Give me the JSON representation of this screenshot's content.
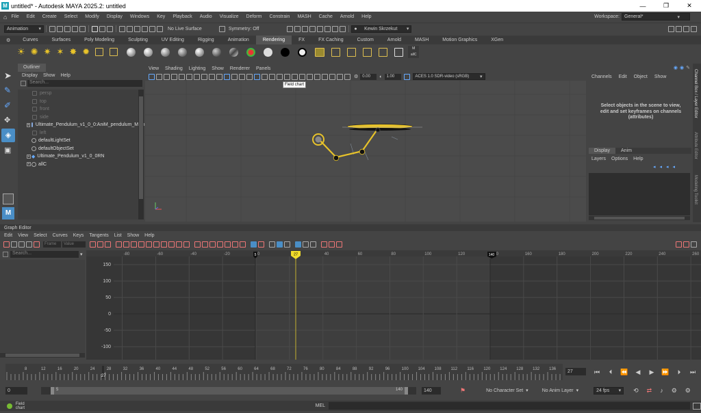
{
  "window": {
    "title": "untitled* - Autodesk MAYA 2025.2: untitled",
    "controls": [
      "—",
      "❐",
      "✕"
    ]
  },
  "main_menu": [
    "File",
    "Edit",
    "Create",
    "Select",
    "Modify",
    "Display",
    "Windows",
    "Key",
    "Playback",
    "Audio",
    "Visualize",
    "Deform",
    "Constrain",
    "MASH",
    "Cache",
    "Arnold",
    "Help"
  ],
  "workspace": {
    "label": "Workspace:",
    "value": "General*"
  },
  "status_line": {
    "menu_set": "Animation",
    "live_surface": "No Live Surface",
    "symmetry": "Symmetry: Off",
    "user": "Kewin Skrzekut"
  },
  "shelf_tabs": [
    "Curves",
    "Surfaces",
    "Poly Modeling",
    "Sculpting",
    "UV Editing",
    "Rigging",
    "Animation",
    "Rendering",
    "FX",
    "FX Caching",
    "Custom",
    "Arnold",
    "MASH",
    "Motion Graphics",
    "XGen"
  ],
  "shelf_active": "Rendering",
  "shelf_last_label": "allC",
  "outliner": {
    "title": "Outliner",
    "menu": [
      "Display",
      "Show",
      "Help"
    ],
    "search_placeholder": "Search...",
    "items": [
      {
        "label": "persp"
      },
      {
        "label": "top"
      },
      {
        "label": "front"
      },
      {
        "label": "side"
      },
      {
        "label": "Ultimate_Pendulum_v1_0_0:AniM_pendulum_Main"
      },
      {
        "label": "left"
      },
      {
        "label": "defaultLightSet"
      },
      {
        "label": "defaultObjectSet"
      },
      {
        "label": "Ultimate_Pendulum_v1_0_0RN"
      },
      {
        "label": "allC"
      }
    ]
  },
  "viewport": {
    "menu": [
      "View",
      "Shading",
      "Lighting",
      "Show",
      "Renderer",
      "Panels"
    ],
    "exposure": "0.00",
    "gamma": "1.00",
    "color_space": "ACES 1.0 SDR-video (sRGB)",
    "tooltip": "Field chart"
  },
  "channel_box": {
    "menu": [
      "Channels",
      "Edit",
      "Object",
      "Show"
    ],
    "message": "Select objects in the scene to view, edit and set keyframes on channels (attributes)",
    "tabs": [
      "Display",
      "Anim"
    ],
    "layer_menu": [
      "Layers",
      "Options",
      "Help"
    ],
    "side_tabs": [
      "Channel Box / Layer Editor",
      "Attribute Editor",
      "Modeling Toolkit"
    ]
  },
  "graph_editor": {
    "title": "Graph Editor",
    "menu": [
      "Edit",
      "View",
      "Select",
      "Curves",
      "Keys",
      "Tangents",
      "List",
      "Show",
      "Help"
    ],
    "frame_label": "Frame",
    "value_label": "Value",
    "search_placeholder": "Search...",
    "x_ticks": [
      "-80",
      "-60",
      "-40",
      "-20",
      "0",
      "20",
      "40",
      "60",
      "80",
      "100",
      "120",
      "140",
      "160",
      "180",
      "200",
      "220",
      "240",
      "260"
    ],
    "y_ticks": [
      "150",
      "100",
      "50",
      "0",
      "-50",
      "-100"
    ],
    "range_start_marker": "5",
    "current_frame_marker": "27",
    "range_end_marker": "140"
  },
  "time_slider": {
    "ticks": [
      "8",
      "12",
      "16",
      "20",
      "24",
      "28",
      "32",
      "36",
      "40",
      "44",
      "48",
      "52",
      "56",
      "60",
      "64",
      "68",
      "72",
      "76",
      "80",
      "84",
      "88",
      "92",
      "96",
      "100",
      "104",
      "108",
      "112",
      "116",
      "120",
      "124",
      "128",
      "132",
      "136",
      "14"
    ],
    "current": "27",
    "current_field": "27"
  },
  "range_slider": {
    "start": "0",
    "inner_start": "5",
    "inner_end": "140",
    "end": "140",
    "character_set": "No Character Set",
    "anim_layer": "No Anim Layer",
    "fps": "24 fps"
  },
  "help_line": {
    "mel": "MEL",
    "message": "Field chart"
  },
  "colors": {
    "accent_yellow": "#e8c32a",
    "active_blue": "#4a8ec6",
    "bg": "#444444"
  }
}
